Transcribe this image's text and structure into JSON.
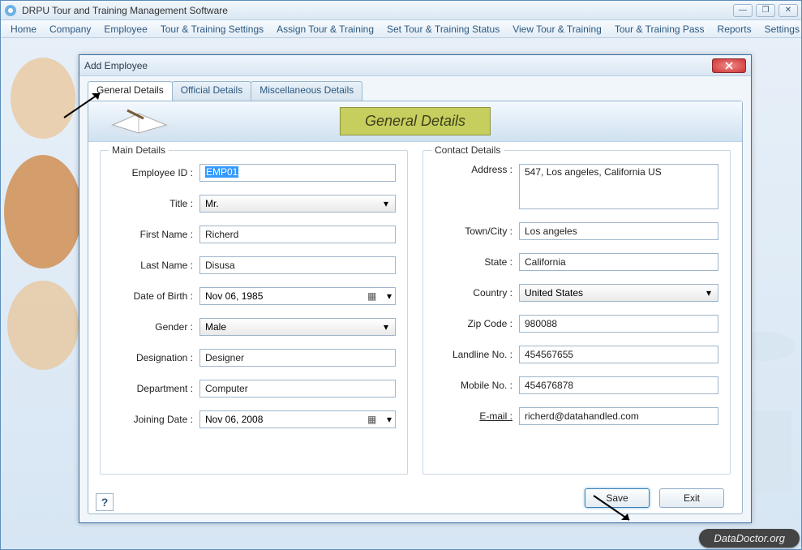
{
  "app": {
    "title": "DRPU Tour and Training Management Software"
  },
  "menu": [
    "Home",
    "Company",
    "Employee",
    "Tour & Training Settings",
    "Assign Tour & Training",
    "Set Tour & Training Status",
    "View Tour & Training",
    "Tour & Training Pass",
    "Reports",
    "Settings"
  ],
  "dialog": {
    "title": "Add Employee",
    "tabs": [
      "General Details",
      "Official Details",
      "Miscellaneous Details"
    ],
    "banner": "General Details",
    "groups": {
      "main": "Main Details",
      "contact": "Contact Details"
    },
    "main": {
      "employee_id": {
        "label": "Employee ID :",
        "value": "EMP01"
      },
      "title": {
        "label": "Title :",
        "value": "Mr."
      },
      "first_name": {
        "label": "First Name :",
        "value": "Richerd"
      },
      "last_name": {
        "label": "Last Name :",
        "value": "Disusa"
      },
      "dob": {
        "label": "Date of Birth :",
        "value": "Nov 06, 1985"
      },
      "gender": {
        "label": "Gender :",
        "value": "Male"
      },
      "designation": {
        "label": "Designation :",
        "value": "Designer"
      },
      "department": {
        "label": "Department :",
        "value": "Computer"
      },
      "joining": {
        "label": "Joining Date :",
        "value": "Nov 06, 2008"
      }
    },
    "contact": {
      "address": {
        "label": "Address :",
        "value": "547, Los angeles, California US"
      },
      "town": {
        "label": "Town/City :",
        "value": "Los angeles"
      },
      "state": {
        "label": "State :",
        "value": "California"
      },
      "country": {
        "label": "Country :",
        "value": "United States"
      },
      "zip": {
        "label": "Zip Code :",
        "value": "980088"
      },
      "landline": {
        "label": "Landline No. :",
        "value": "454567655"
      },
      "mobile": {
        "label": "Mobile No. :",
        "value": "454676878"
      },
      "email": {
        "label": "E-mail :",
        "value": "richerd@datahandled.com"
      }
    },
    "buttons": {
      "save": "Save",
      "exit": "Exit"
    },
    "help": "?"
  },
  "watermark": "DataDoctor.org"
}
